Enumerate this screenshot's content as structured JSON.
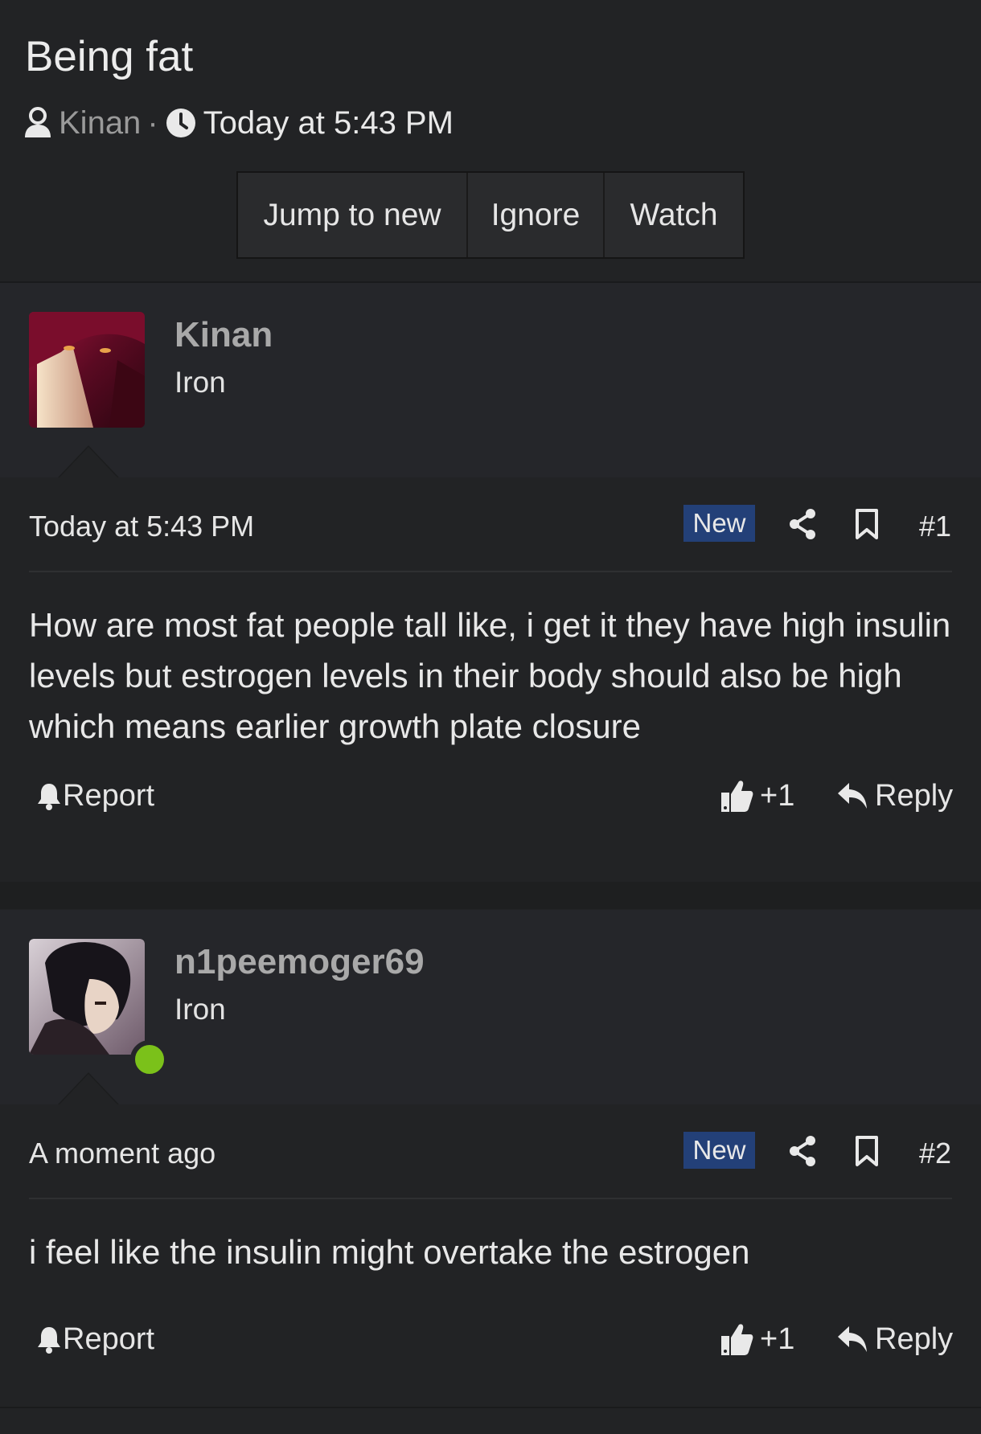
{
  "thread": {
    "title": "Being fat",
    "author": "Kinan",
    "separator": "·",
    "time": "Today at 5:43 PM"
  },
  "buttons": {
    "jump": "Jump to new",
    "ignore": "Ignore",
    "watch": "Watch"
  },
  "posts": [
    {
      "username": "Kinan",
      "user_title": "Iron",
      "date": "Today at 5:43 PM",
      "badge": "New",
      "number": "#1",
      "message": "How are most fat people tall like, i get it they have high insulin levels but estrogen levels in their body should also be high which means earlier growth plate closure",
      "report": "Report",
      "like": "+1",
      "reply": "Reply"
    },
    {
      "username": "n1peemoger69",
      "user_title": "Iron",
      "date": "A moment ago",
      "badge": "New",
      "number": "#2",
      "message": "i feel like the insulin might overtake the estrogen",
      "report": "Report",
      "like": "+1",
      "reply": "Reply"
    }
  ],
  "icons": [
    "user-icon",
    "clock-icon",
    "share-icon",
    "bookmark-icon",
    "bell-icon",
    "thumbs-up-icon",
    "reply-arrow-icon"
  ],
  "colors": {
    "badge_new": "#234078",
    "online_indicator": "#7bc11a",
    "username": "#a9a9a9"
  }
}
